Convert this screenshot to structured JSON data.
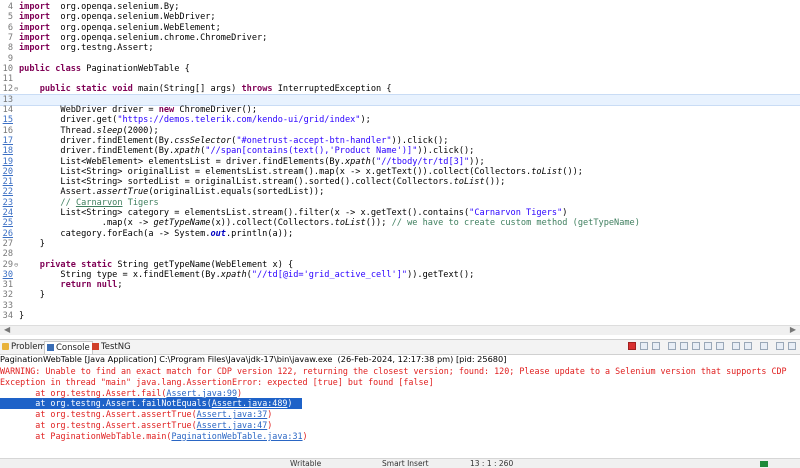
{
  "editor": {
    "lines": [
      {
        "n": "4",
        "tokens": [
          [
            "kw",
            "import"
          ],
          [
            "",
            "  org.openqa.selenium.By;"
          ]
        ]
      },
      {
        "n": "5",
        "tokens": [
          [
            "kw",
            "import"
          ],
          [
            "",
            "  org.openqa.selenium.WebDriver;"
          ]
        ]
      },
      {
        "n": "6",
        "tokens": [
          [
            "kw",
            "import"
          ],
          [
            "",
            "  org.openqa.selenium.WebElement;"
          ]
        ]
      },
      {
        "n": "7",
        "tokens": [
          [
            "kw",
            "import"
          ],
          [
            "",
            "  org.openqa.selenium.chrome.ChromeDriver;"
          ]
        ]
      },
      {
        "n": "8",
        "tokens": [
          [
            "kw",
            "import"
          ],
          [
            "",
            "  org.testng.Assert;"
          ]
        ]
      },
      {
        "n": "9",
        "tokens": []
      },
      {
        "n": "10",
        "tokens": [
          [
            "kw",
            "public class"
          ],
          [
            "",
            " PaginationWebTable {"
          ]
        ]
      },
      {
        "n": "11",
        "tokens": []
      },
      {
        "n": "12",
        "ov": "⊖",
        "tokens": [
          [
            "",
            "    "
          ],
          [
            "kw",
            "public static void"
          ],
          [
            "",
            " main(String[] args) "
          ],
          [
            "kw",
            "throws"
          ],
          [
            "",
            " InterruptedException {"
          ]
        ]
      },
      {
        "n": "13",
        "current": true,
        "tokens": []
      },
      {
        "n": "14",
        "tokens": [
          [
            "",
            "        WebDriver driver = "
          ],
          [
            "kw",
            "new"
          ],
          [
            "",
            " ChromeDriver();"
          ]
        ]
      },
      {
        "n": "15",
        "changed": true,
        "tokens": [
          [
            "",
            "        driver.get("
          ],
          [
            "str",
            "\"https://demos.telerik.com/kendo-ui/grid/index\""
          ],
          [
            "",
            ");"
          ]
        ]
      },
      {
        "n": "16",
        "tokens": [
          [
            "",
            "        Thread."
          ],
          [
            "it",
            "sleep"
          ],
          [
            "",
            "(2000);"
          ]
        ]
      },
      {
        "n": "17",
        "changed": true,
        "tokens": [
          [
            "",
            "        driver.findElement(By."
          ],
          [
            "it",
            "cssSelector"
          ],
          [
            "",
            "("
          ],
          [
            "str",
            "\"#onetrust-accept-btn-handler\""
          ],
          [
            "",
            "))."
          ],
          [
            "",
            "click();"
          ]
        ]
      },
      {
        "n": "18",
        "changed": true,
        "tokens": [
          [
            "",
            "        driver.findElement(By."
          ],
          [
            "it",
            "xpath"
          ],
          [
            "",
            "("
          ],
          [
            "str",
            "\"//span[contains(text(),'Product Name')]\""
          ],
          [
            "",
            "))."
          ],
          [
            "",
            "click();"
          ]
        ]
      },
      {
        "n": "19",
        "changed": true,
        "tokens": [
          [
            "",
            "        List<WebElement> elementsList = driver.findElements(By."
          ],
          [
            "it",
            "xpath"
          ],
          [
            "",
            "("
          ],
          [
            "str",
            "\"//tbody/tr/td[3]\""
          ],
          [
            "",
            "));"
          ]
        ]
      },
      {
        "n": "20",
        "changed": true,
        "tokens": [
          [
            "",
            "        List<String> originalList = elementsList.stream().map(x -> x.getText()).collect(Collectors."
          ],
          [
            "it",
            "toList"
          ],
          [
            "",
            "());"
          ]
        ]
      },
      {
        "n": "21",
        "changed": true,
        "tokens": [
          [
            "",
            "        List<String> sortedList = originalList.stream().sorted().collect(Collectors."
          ],
          [
            "it",
            "toList"
          ],
          [
            "",
            "());"
          ]
        ]
      },
      {
        "n": "22",
        "changed": true,
        "tokens": [
          [
            "",
            "        Assert."
          ],
          [
            "it",
            "assertTrue"
          ],
          [
            "",
            "(originalList.equals(sortedList));"
          ]
        ]
      },
      {
        "n": "23",
        "changed": true,
        "tokens": [
          [
            "",
            "        "
          ],
          [
            "cm",
            "// "
          ],
          [
            "cm ul",
            "Carnarvon"
          ],
          [
            "cm",
            " Tigers"
          ]
        ]
      },
      {
        "n": "24",
        "changed": true,
        "tokens": [
          [
            "",
            "        List<String> category = elementsList.stream().filter(x -> x.getText().contains("
          ],
          [
            "str",
            "\"Carnarvon Tigers\""
          ],
          [
            "",
            ")"
          ]
        ]
      },
      {
        "n": "25",
        "changed": true,
        "tokens": [
          [
            "",
            "                .map(x -> "
          ],
          [
            "it",
            "getTypeName"
          ],
          [
            "",
            "(x)).collect(Collectors."
          ],
          [
            "it",
            "toList"
          ],
          [
            "",
            "()); "
          ],
          [
            "cm",
            "// we have to create custom method (getTypeName)"
          ]
        ]
      },
      {
        "n": "26",
        "changed": true,
        "tokens": [
          [
            "",
            "        category.forEach(a -> System."
          ],
          [
            "fldb",
            "out"
          ],
          [
            "",
            ".println(a));"
          ]
        ]
      },
      {
        "n": "27",
        "tokens": [
          [
            "",
            "    }"
          ]
        ]
      },
      {
        "n": "28",
        "tokens": []
      },
      {
        "n": "29",
        "ov": "⊖",
        "tokens": [
          [
            "",
            "    "
          ],
          [
            "kw",
            "private static"
          ],
          [
            "",
            " String getTypeName(WebElement x) {"
          ]
        ]
      },
      {
        "n": "30",
        "changed": true,
        "tokens": [
          [
            "",
            "        String type = x.findElement(By."
          ],
          [
            "it",
            "xpath"
          ],
          [
            "",
            "("
          ],
          [
            "str",
            "\"//td[@id='grid_active_cell']\""
          ],
          [
            "",
            ")).getText();"
          ]
        ]
      },
      {
        "n": "31",
        "tokens": [
          [
            "",
            "        "
          ],
          [
            "kw",
            "return null"
          ],
          [
            "",
            ";"
          ]
        ]
      },
      {
        "n": "32",
        "tokens": [
          [
            "",
            "    }"
          ]
        ]
      },
      {
        "n": "33",
        "tokens": []
      },
      {
        "n": "34",
        "tokens": [
          [
            "",
            "}"
          ]
        ]
      }
    ]
  },
  "tabs": [
    {
      "label": "Problems",
      "icon": "problems-icon",
      "active": false
    },
    {
      "label": "Console",
      "icon": "console-icon",
      "active": true
    },
    {
      "label": "TestNG",
      "icon": "testng-icon",
      "active": false
    }
  ],
  "console": {
    "header": "PaginationWebTable [Java Application] C:\\Program Files\\Java\\jdk-17\\bin\\javaw.exe  (26-Feb-2024, 12:17:38 pm) [pid: 25680]",
    "lines": [
      {
        "text": "WARNING: Unable to find an exact match for CDP version 122, returning the closest version; found: 120; Please update to a Selenium version that supports CDP"
      },
      {
        "text": "Exception in thread \"main\" java.lang.AssertionError: expected [true] but found [false]"
      },
      {
        "text": "\tat org.testng.Assert.fail(",
        "link": "Assert.java:99",
        "tail": ")"
      },
      {
        "text": "\tat org.testng.Assert.failNotEquals(",
        "link": "Assert.java:489",
        "tail": ")",
        "selected": true
      },
      {
        "text": "\tat org.testng.Assert.assertTrue(",
        "link": "Assert.java:37",
        "tail": ")"
      },
      {
        "text": "\tat org.testng.Assert.assertTrue(",
        "link": "Assert.java:47",
        "tail": ")"
      },
      {
        "text": "\tat PaginationWebTable.main(",
        "link": "PaginationWebTable.java:31",
        "tail": ")"
      }
    ]
  },
  "status": {
    "writable": "Writable",
    "insert_mode": "Smart Insert",
    "position": "13 : 1 : 260"
  }
}
